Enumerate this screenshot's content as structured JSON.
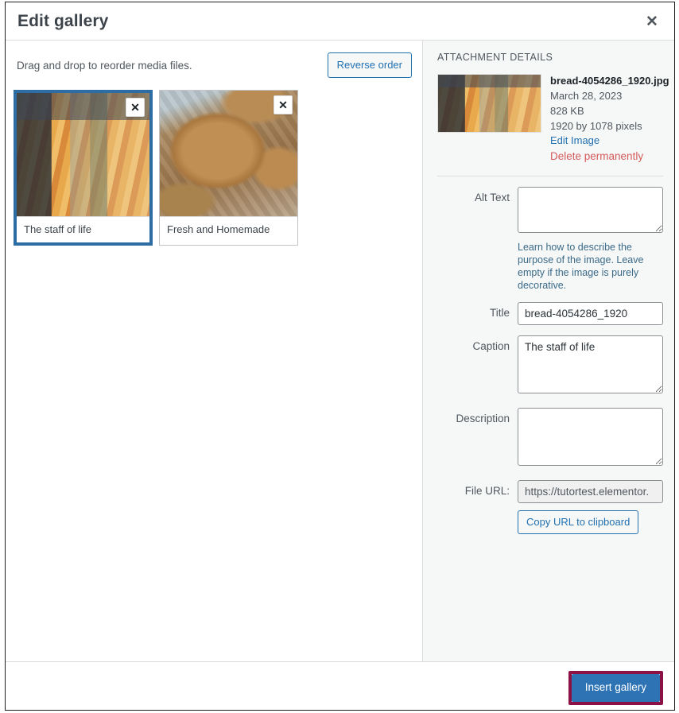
{
  "modal": {
    "title": "Edit gallery",
    "close_label": "✕"
  },
  "toolbar": {
    "hint": "Drag and drop to reorder media files.",
    "reverse_order_label": "Reverse order"
  },
  "gallery": {
    "items": [
      {
        "caption": "The staff of life",
        "remove_label": "✕",
        "selected": true
      },
      {
        "caption": "Fresh and Homemade",
        "remove_label": "✕",
        "selected": false
      }
    ]
  },
  "sidebar": {
    "heading": "ATTACHMENT DETAILS",
    "attachment": {
      "filename": "bread-4054286_1920.jpg",
      "date": "March 28, 2023",
      "filesize": "828 KB",
      "dimensions": "1920 by 1078 pixels",
      "edit_image_label": "Edit Image",
      "delete_label": "Delete permanently"
    },
    "fields": {
      "alt_text_label": "Alt Text",
      "alt_text_value": "",
      "alt_text_hint": "Learn how to describe the purpose of the image. Leave empty if the image is purely decorative.",
      "title_label": "Title",
      "title_value": "bread-4054286_1920",
      "caption_label": "Caption",
      "caption_value": "The staff of life",
      "description_label": "Description",
      "description_value": "",
      "file_url_label": "File URL:",
      "file_url_value": "https://tutortest.elementor.",
      "copy_url_label": "Copy URL to clipboard"
    }
  },
  "footer": {
    "insert_gallery_label": "Insert gallery"
  },
  "colors": {
    "accent_blue": "#2271b1",
    "primary_button": "#2e74b5",
    "highlight_border": "#8c1145",
    "selected_thumb_border": "#2e6ca4",
    "danger_red": "#d45c5c",
    "sidebar_bg": "#f6f7f7"
  }
}
